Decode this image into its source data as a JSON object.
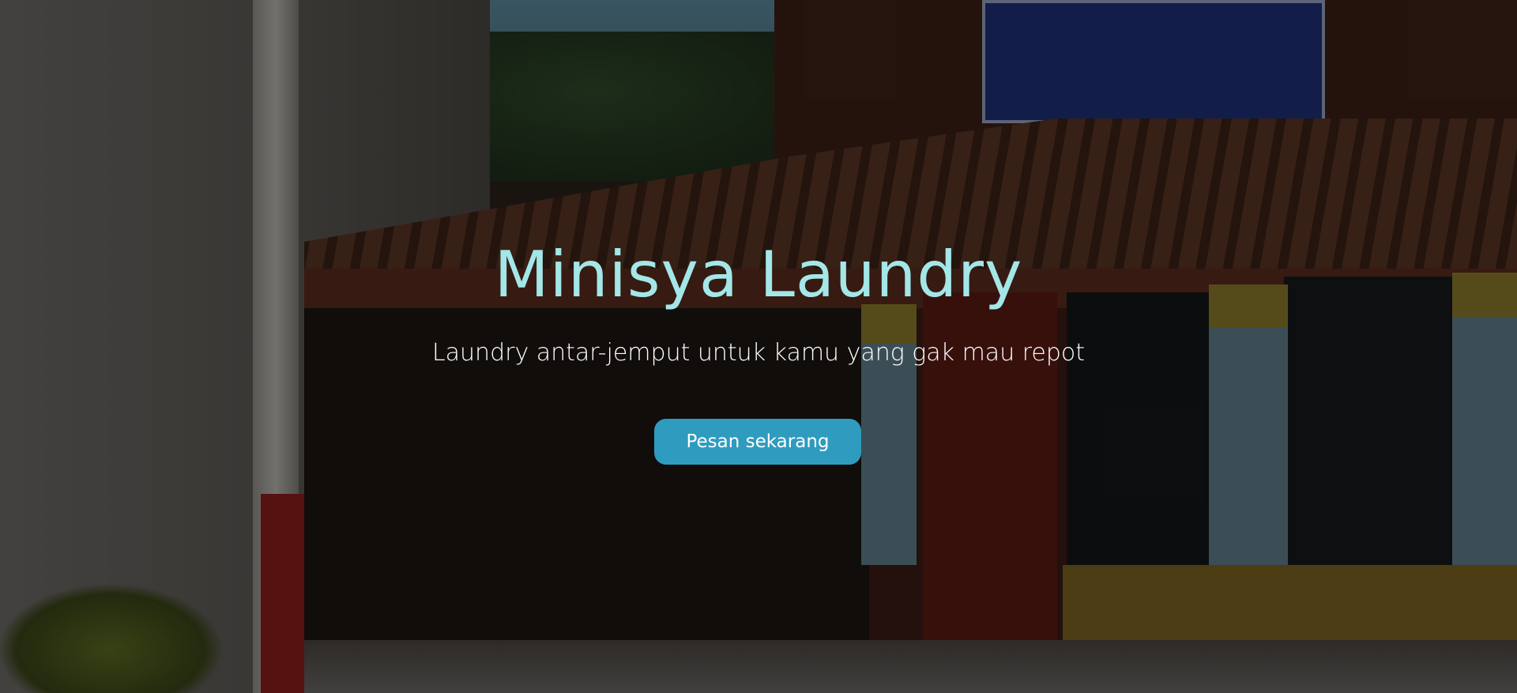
{
  "hero": {
    "title": "Minisya Laundry",
    "subtitle": "Laundry antar-jemput untuk kamu yang gak mau repot",
    "cta_label": "Pesan sekarang",
    "colors": {
      "title": "#a3e7e8",
      "cta_background": "#2f9bbf",
      "cta_text": "#ffffff"
    }
  }
}
